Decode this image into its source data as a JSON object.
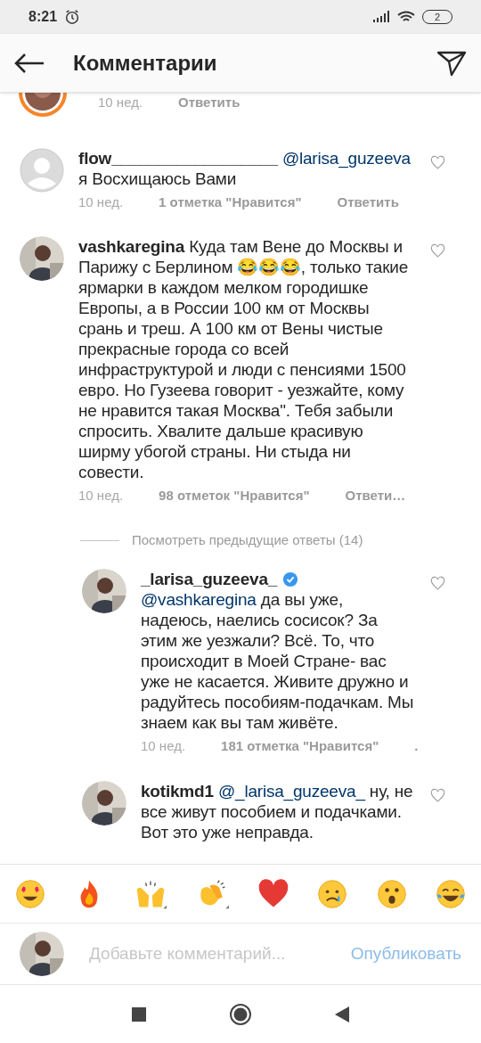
{
  "status_bar": {
    "time": "8:21",
    "battery": "2"
  },
  "header": {
    "title": "Комментарии"
  },
  "partial_comment": {
    "time": "10 нед.",
    "reply": "Ответить"
  },
  "comments": [
    {
      "username": "flow__________________",
      "default_avatar": true,
      "mention": "@larisa_guzeeva",
      "text": "я Восхищаюсь Вами",
      "liked": false,
      "time": "10 нед.",
      "likes": "1 отметка \"Нравится\"",
      "reply": "Ответить"
    },
    {
      "username": "vashkaregina",
      "default_avatar": false,
      "text": "Куда там Вене до Москвы и Парижу с Берлином 😂😂😂, только такие ярмарки в каждом мелком городишке Европы, а  в России 100 км от Москвы срань и треш.  А 100 км от Вены чистые прекрасные города со всей инфраструктурой  и люди с пенсиями 1500 евро.  Но Гузеева говорит - уезжайте, кому не нравится такая Москва\". Тебя забыли спросить. Хвалите дальше красивую  ширму убогой страны. Ни стыда ни совести.",
      "liked": false,
      "time": "10 нед.",
      "likes": "98 отметок \"Нравится\"",
      "reply": "Ответи…",
      "previous_replies": "Посмотреть предыдущие ответы (14)",
      "replies": [
        {
          "username": "_larisa_guzeeva_",
          "default_avatar": false,
          "verified": true,
          "mention": "@vashkaregina",
          "text": "да вы уже, надеюсь, наелись сосисок? За этим же уезжали? Всё. То, что происходит в Моей Стране- вас уже не касается. Живите дружно и радуйтесь пособиям-подачкам. Мы знаем как вы там живёте.",
          "liked": false,
          "time": "10 нед.",
          "likes": "181 отметка \"Нравится\"",
          "reply": "."
        },
        {
          "username": "kotikmd1",
          "default_avatar": false,
          "mention": "@_larisa_guzeeva_",
          "text": "ну, не все живут пособием и подачками. Вот это уже неправда.",
          "liked": false
        }
      ]
    }
  ],
  "composer": {
    "placeholder": "Добавьте комментарий...",
    "button": "Опубликовать",
    "disabled": true
  }
}
